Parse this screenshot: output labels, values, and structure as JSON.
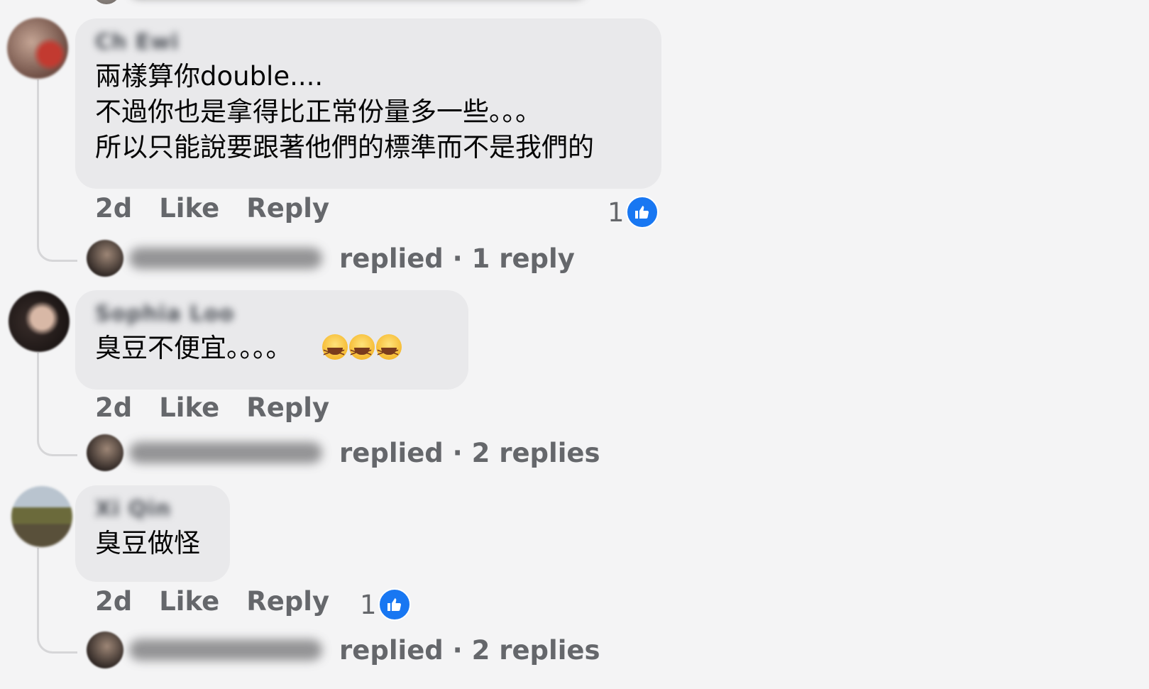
{
  "comments": [
    {
      "author": "Ch Ewi",
      "text_lines": [
        "兩樣算你double....",
        "不過你也是拿得比正常份量多一些。。。",
        "所以只能說要跟著他們的標準而不是我們的"
      ],
      "time": "2d",
      "like_label": "Like",
      "reply_label": "Reply",
      "reaction_count": "1",
      "reply_summary": "replied · 1 reply"
    },
    {
      "author": "Sophia Loo",
      "text": "臭豆不便宜。。。。",
      "emoji": "laughing-emoji",
      "time": "2d",
      "like_label": "Like",
      "reply_label": "Reply",
      "reply_summary": "replied · 2 replies"
    },
    {
      "author": "Xi Qin",
      "text": "臭豆做怪",
      "time": "2d",
      "like_label": "Like",
      "reply_label": "Reply",
      "reaction_count": "1",
      "reply_summary": "replied · 2 replies"
    }
  ],
  "colors": {
    "bubble": "#e9e9eb",
    "meta": "#65676b",
    "like_blue": "#1877f2",
    "background": "#f4f4f5"
  }
}
